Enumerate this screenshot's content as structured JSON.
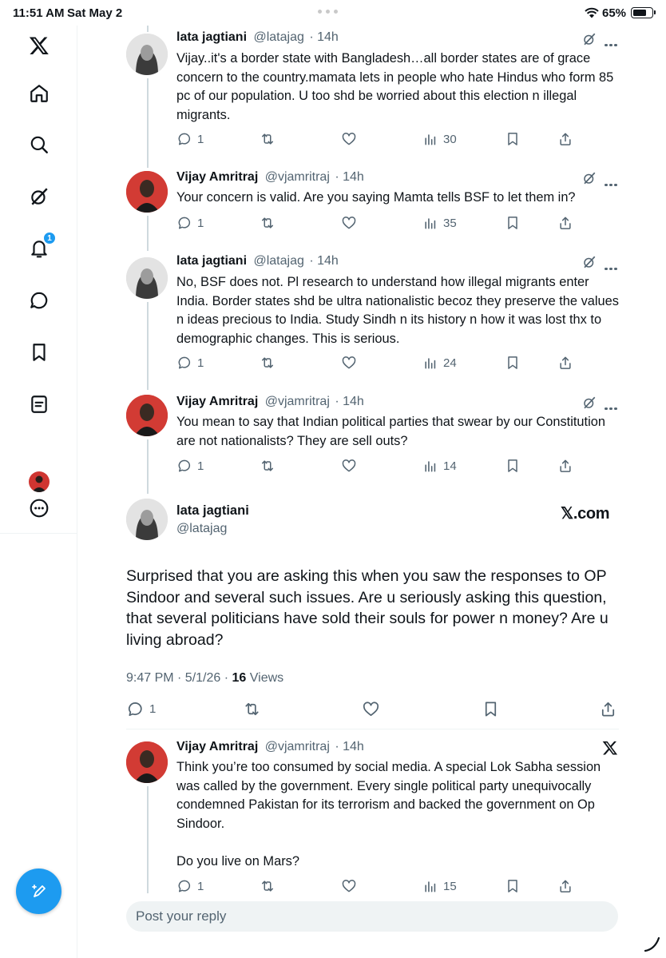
{
  "status_bar": {
    "time": "11:51 AM",
    "date": "Sat May 2",
    "battery": "65%"
  },
  "sidebar": {
    "items": [
      {
        "icon": "x-logo-icon"
      },
      {
        "icon": "home-icon"
      },
      {
        "icon": "search-icon"
      },
      {
        "icon": "grok-icon"
      },
      {
        "icon": "bell-icon",
        "badge": "1"
      },
      {
        "icon": "messages-icon"
      },
      {
        "icon": "bookmark-icon"
      },
      {
        "icon": "lists-icon"
      },
      {
        "icon": "profile-avatar"
      },
      {
        "icon": "more-icon"
      }
    ]
  },
  "thread": [
    {
      "name": "lata jagtiani",
      "handle": "@latajag",
      "age": "· 14h",
      "text": "Vijay..it's a border state with Bangladesh…all border states are of grace concern to the country.mamata lets in people who hate Hindus who form 85 pc of our population. U too shd be worried about this election n illegal migrants.",
      "replies": "1",
      "views": "30"
    },
    {
      "name": "Vijay Amritraj",
      "handle": "@vjamritraj",
      "age": "· 14h",
      "text": "Your concern is valid.  Are you saying Mamta tells BSF to let them in?",
      "replies": "1",
      "views": "35"
    },
    {
      "name": "lata jagtiani",
      "handle": "@latajag",
      "age": "· 14h",
      "text": "No, BSF does not. Pl research to understand how illegal migrants enter India. Border states shd be ultra nationalistic becoz they preserve the values n ideas precious to India. Study Sindh n its history n how it was lost thx to demographic changes. This is serious.",
      "replies": "1",
      "views": "24"
    },
    {
      "name": "Vijay Amritraj",
      "handle": "@vjamritraj",
      "age": "· 14h",
      "text": "You mean to say that Indian political parties that swear by our Constitution are not nationalists? They are sell outs?",
      "replies": "1",
      "views": "14"
    }
  ],
  "focus": {
    "name": "lata jagtiani",
    "handle": "@latajag",
    "source": "𝕏.com",
    "text": "Surprised that you are asking this when you saw the responses to OP Sindoor and several such issues. Are u seriously asking this question, that several politicians have sold their souls for power n money?  Are u living abroad?",
    "timestamp": "9:47 PM · 5/1/26 · ",
    "views_count": "16",
    "views_label": " Views",
    "replies": "1"
  },
  "reply": {
    "name": "Vijay Amritraj",
    "handle": "@vjamritraj",
    "age": "· 14h",
    "text_p1": "Think you’re too consumed by social media. A special Lok Sabha session was called by the government. Every single political party unequivocally  condemned Pakistan for its terrorism and backed the government on Op Sindoor.",
    "text_p2": "Do you live on Mars?",
    "replies": "1",
    "views": "15"
  },
  "compose": {
    "placeholder": "Post your reply"
  },
  "colors": {
    "accent": "#1d9bf0",
    "text": "#0f1419",
    "secondary": "#536471"
  }
}
